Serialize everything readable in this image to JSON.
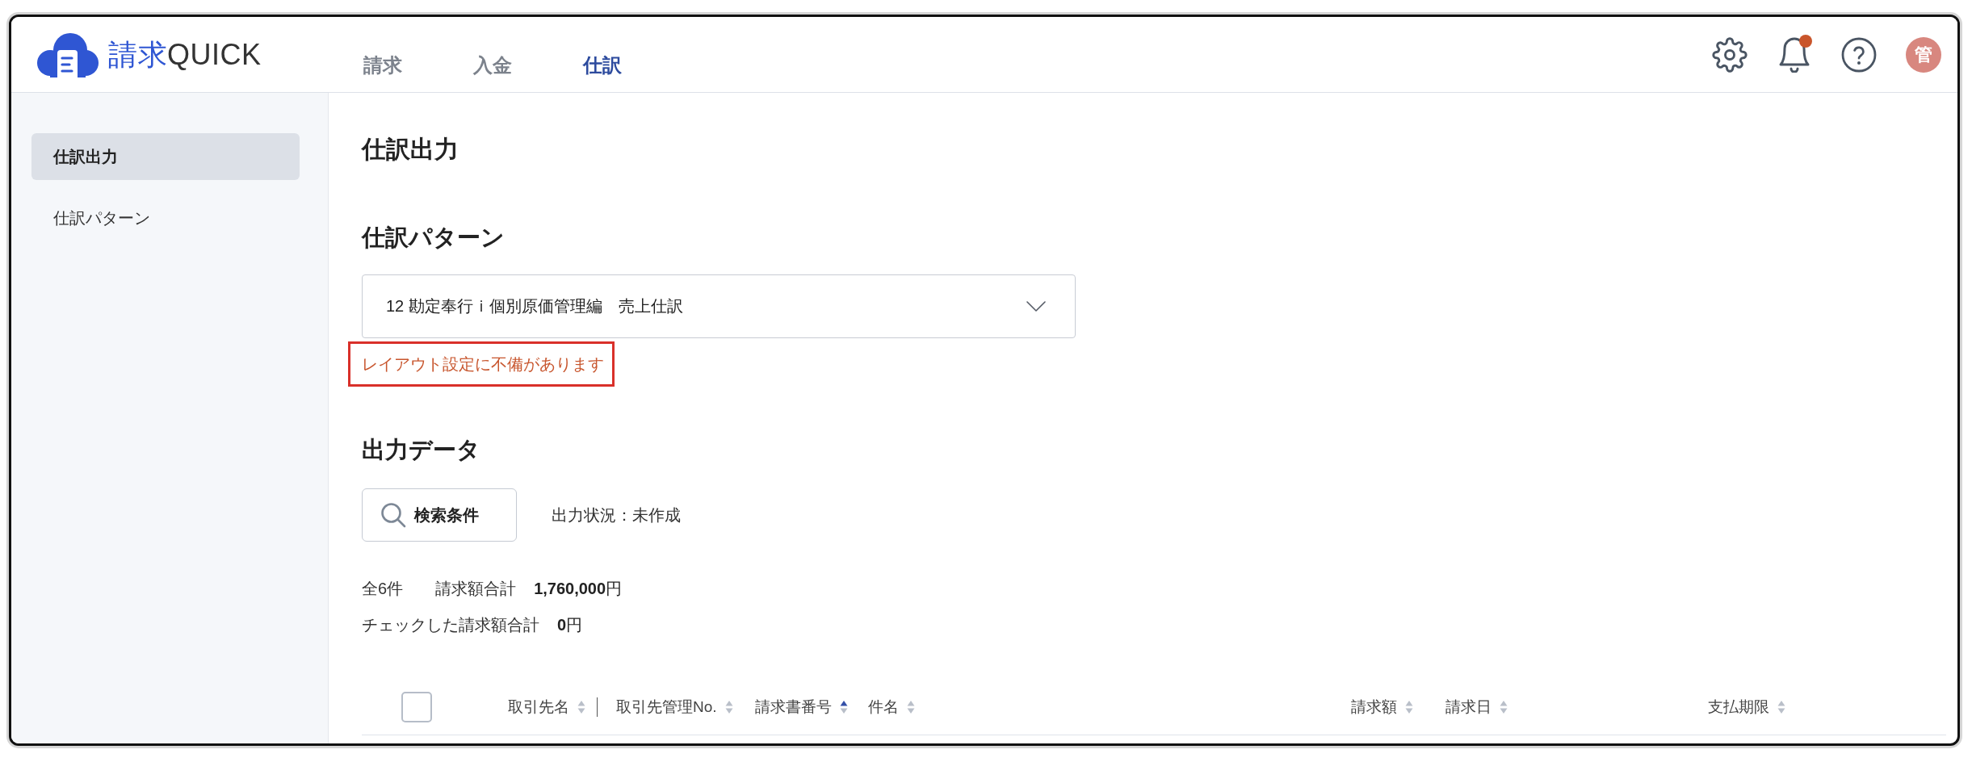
{
  "header": {
    "logo_text": [
      {
        "text": "請求",
        "kind": "accent"
      },
      {
        "text": "QUICK",
        "kind": "plain"
      }
    ],
    "nav": [
      {
        "label": "請求",
        "selected": false
      },
      {
        "label": "入金",
        "selected": false
      },
      {
        "label": "仕訳",
        "selected": true
      }
    ],
    "notifications": {
      "unread": true
    },
    "avatar": {
      "text": "管"
    }
  },
  "sidebar": {
    "items": [
      {
        "label": "仕訳出力",
        "selected": true
      },
      {
        "label": "仕訳パターン",
        "selected": false
      }
    ]
  },
  "page_title": "仕訳出力",
  "pattern_section": {
    "heading": "仕訳パターン",
    "select": {
      "value": "12 勘定奉行ｉ個別原価管理編　売上仕訳"
    },
    "error": {
      "text": "レイアウト設定に不備があります",
      "highlighted": true
    }
  },
  "output_section": {
    "heading": "出力データ",
    "search_button": {
      "label": "検索条件"
    },
    "status": "出力状況：未作成",
    "summary": {
      "total_count": "全6件",
      "total_label": "請求額合計",
      "total_amount": "**1,760,000**円",
      "checked_label": "チェックした請求額合計",
      "checked_amount": "**0**円"
    },
    "table": {
      "select_all": {
        "checked": false
      },
      "columns": [
        {
          "label": "取引先名",
          "sorted": false
        },
        {
          "label": "取引先管理No.",
          "sorted": false
        },
        {
          "label": "請求書番号",
          "sorted": true
        },
        {
          "label": "件名",
          "sorted": false
        },
        {
          "label": "請求額",
          "sorted": false
        },
        {
          "label": "請求日",
          "sorted": false
        },
        {
          "label": "支払期限",
          "sorted": false
        }
      ]
    }
  }
}
